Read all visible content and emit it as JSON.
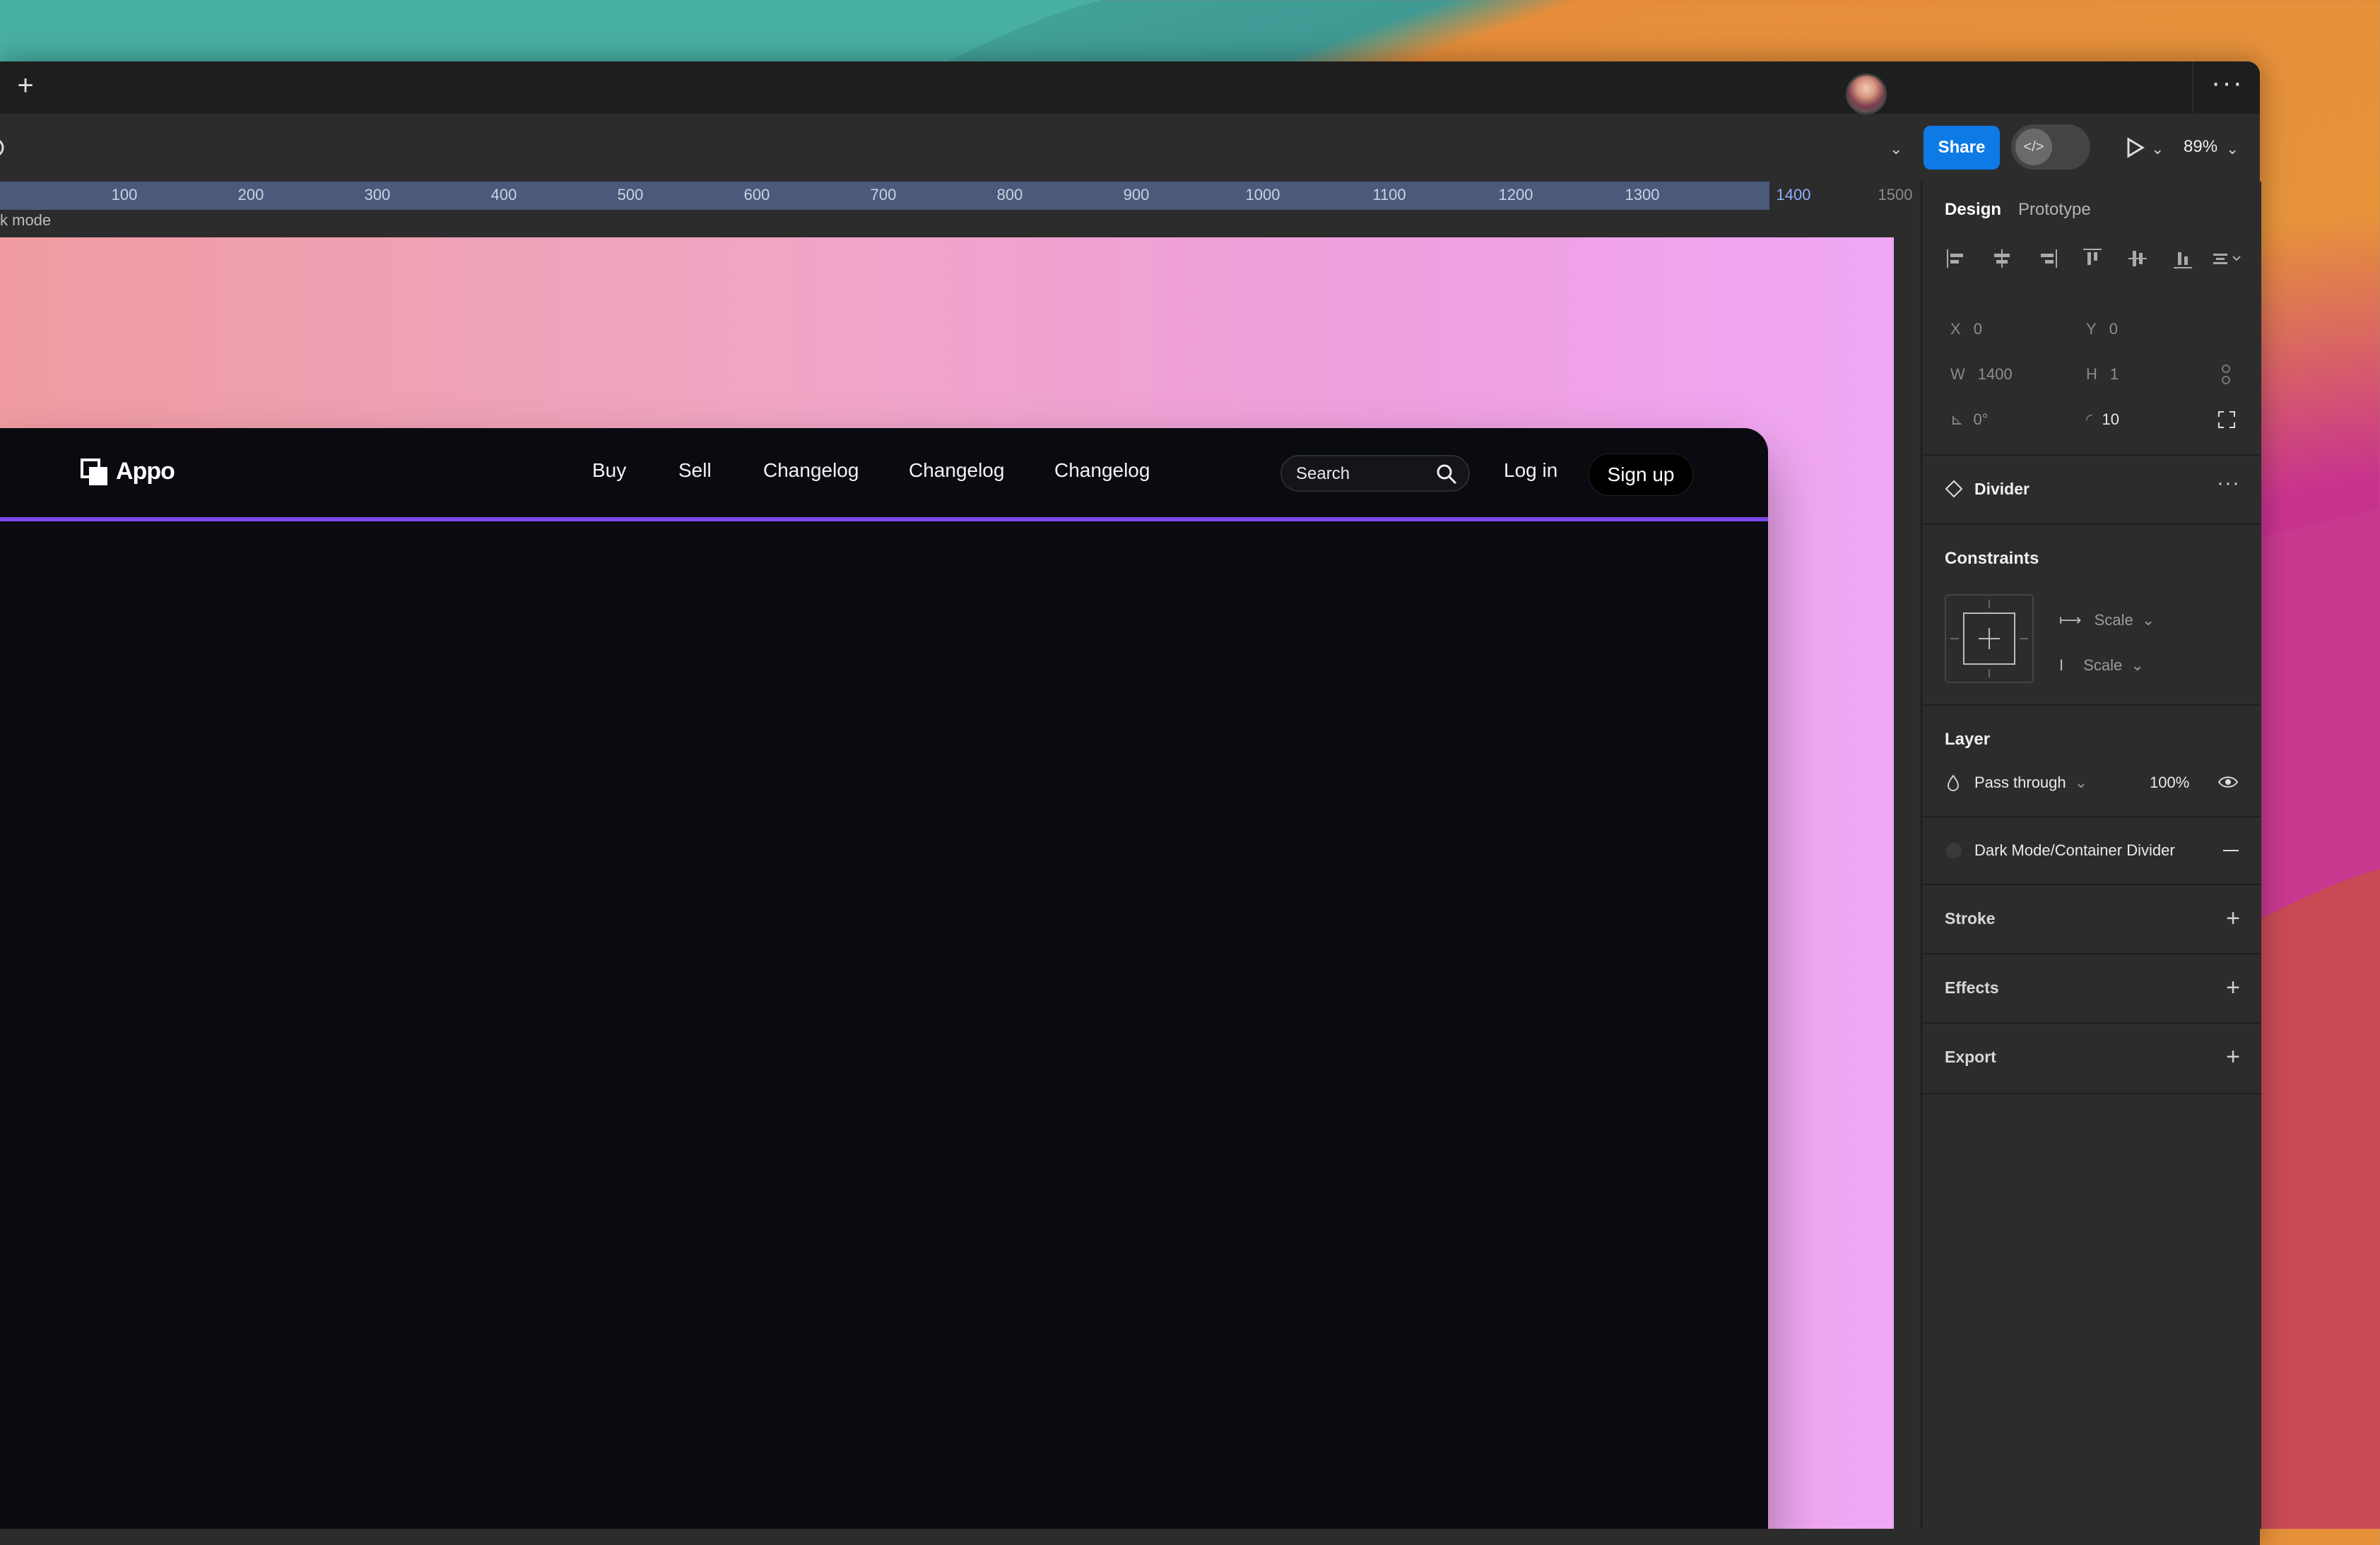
{
  "tabbar": {
    "new_tab": "+",
    "more": "···"
  },
  "toolbar": {
    "share_label": "Share",
    "dev_mode_icon": "code-icon",
    "zoom": "89%"
  },
  "ruler": {
    "ticks": [
      "100",
      "200",
      "300",
      "400",
      "500",
      "600",
      "700",
      "800",
      "900",
      "1000",
      "1100",
      "1200",
      "1300",
      "1400",
      "1500"
    ]
  },
  "canvas": {
    "frame_label": "k mode"
  },
  "site": {
    "logo": "Appo",
    "nav": [
      "Buy",
      "Sell",
      "Changelog",
      "Changelog",
      "Changelog"
    ],
    "search_placeholder": "Search",
    "login": "Log in",
    "signup": "Sign up",
    "accent": "#7a48e8"
  },
  "panel": {
    "tabs": [
      "Design",
      "Prototype"
    ],
    "x_label": "X",
    "x": "0",
    "y_label": "Y",
    "y": "0",
    "w_label": "W",
    "w": "1400",
    "h_label": "H",
    "h": "1",
    "rotation": "0°",
    "radius": "10",
    "component": "Divider",
    "constraints": {
      "title": "Constraints",
      "horizontal": "Scale",
      "vertical": "Scale"
    },
    "layer": {
      "title": "Layer",
      "blend": "Pass through",
      "opacity": "100%"
    },
    "fill_style": "Dark Mode/Container Divider",
    "stroke": "Stroke",
    "effects": "Effects",
    "export": "Export"
  }
}
